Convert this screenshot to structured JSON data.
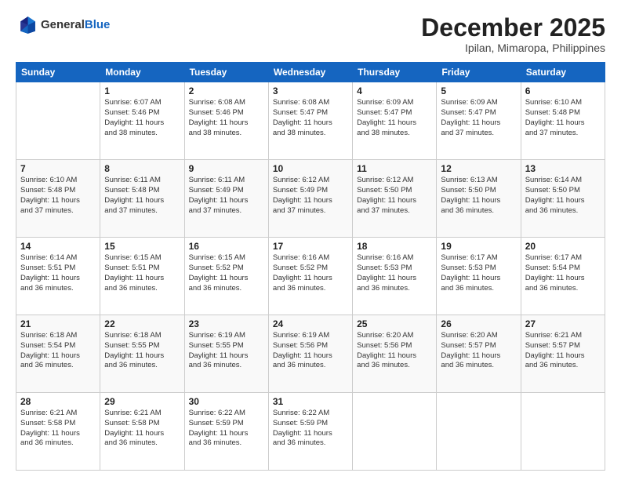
{
  "header": {
    "logo_line1": "General",
    "logo_line2": "Blue",
    "month": "December 2025",
    "location": "Ipilan, Mimaropa, Philippines"
  },
  "weekdays": [
    "Sunday",
    "Monday",
    "Tuesday",
    "Wednesday",
    "Thursday",
    "Friday",
    "Saturday"
  ],
  "weeks": [
    [
      {
        "day": "",
        "info": ""
      },
      {
        "day": "1",
        "info": "Sunrise: 6:07 AM\nSunset: 5:46 PM\nDaylight: 11 hours\nand 38 minutes."
      },
      {
        "day": "2",
        "info": "Sunrise: 6:08 AM\nSunset: 5:46 PM\nDaylight: 11 hours\nand 38 minutes."
      },
      {
        "day": "3",
        "info": "Sunrise: 6:08 AM\nSunset: 5:47 PM\nDaylight: 11 hours\nand 38 minutes."
      },
      {
        "day": "4",
        "info": "Sunrise: 6:09 AM\nSunset: 5:47 PM\nDaylight: 11 hours\nand 38 minutes."
      },
      {
        "day": "5",
        "info": "Sunrise: 6:09 AM\nSunset: 5:47 PM\nDaylight: 11 hours\nand 37 minutes."
      },
      {
        "day": "6",
        "info": "Sunrise: 6:10 AM\nSunset: 5:48 PM\nDaylight: 11 hours\nand 37 minutes."
      }
    ],
    [
      {
        "day": "7",
        "info": "Sunrise: 6:10 AM\nSunset: 5:48 PM\nDaylight: 11 hours\nand 37 minutes."
      },
      {
        "day": "8",
        "info": "Sunrise: 6:11 AM\nSunset: 5:48 PM\nDaylight: 11 hours\nand 37 minutes."
      },
      {
        "day": "9",
        "info": "Sunrise: 6:11 AM\nSunset: 5:49 PM\nDaylight: 11 hours\nand 37 minutes."
      },
      {
        "day": "10",
        "info": "Sunrise: 6:12 AM\nSunset: 5:49 PM\nDaylight: 11 hours\nand 37 minutes."
      },
      {
        "day": "11",
        "info": "Sunrise: 6:12 AM\nSunset: 5:50 PM\nDaylight: 11 hours\nand 37 minutes."
      },
      {
        "day": "12",
        "info": "Sunrise: 6:13 AM\nSunset: 5:50 PM\nDaylight: 11 hours\nand 36 minutes."
      },
      {
        "day": "13",
        "info": "Sunrise: 6:14 AM\nSunset: 5:50 PM\nDaylight: 11 hours\nand 36 minutes."
      }
    ],
    [
      {
        "day": "14",
        "info": "Sunrise: 6:14 AM\nSunset: 5:51 PM\nDaylight: 11 hours\nand 36 minutes."
      },
      {
        "day": "15",
        "info": "Sunrise: 6:15 AM\nSunset: 5:51 PM\nDaylight: 11 hours\nand 36 minutes."
      },
      {
        "day": "16",
        "info": "Sunrise: 6:15 AM\nSunset: 5:52 PM\nDaylight: 11 hours\nand 36 minutes."
      },
      {
        "day": "17",
        "info": "Sunrise: 6:16 AM\nSunset: 5:52 PM\nDaylight: 11 hours\nand 36 minutes."
      },
      {
        "day": "18",
        "info": "Sunrise: 6:16 AM\nSunset: 5:53 PM\nDaylight: 11 hours\nand 36 minutes."
      },
      {
        "day": "19",
        "info": "Sunrise: 6:17 AM\nSunset: 5:53 PM\nDaylight: 11 hours\nand 36 minutes."
      },
      {
        "day": "20",
        "info": "Sunrise: 6:17 AM\nSunset: 5:54 PM\nDaylight: 11 hours\nand 36 minutes."
      }
    ],
    [
      {
        "day": "21",
        "info": "Sunrise: 6:18 AM\nSunset: 5:54 PM\nDaylight: 11 hours\nand 36 minutes."
      },
      {
        "day": "22",
        "info": "Sunrise: 6:18 AM\nSunset: 5:55 PM\nDaylight: 11 hours\nand 36 minutes."
      },
      {
        "day": "23",
        "info": "Sunrise: 6:19 AM\nSunset: 5:55 PM\nDaylight: 11 hours\nand 36 minutes."
      },
      {
        "day": "24",
        "info": "Sunrise: 6:19 AM\nSunset: 5:56 PM\nDaylight: 11 hours\nand 36 minutes."
      },
      {
        "day": "25",
        "info": "Sunrise: 6:20 AM\nSunset: 5:56 PM\nDaylight: 11 hours\nand 36 minutes."
      },
      {
        "day": "26",
        "info": "Sunrise: 6:20 AM\nSunset: 5:57 PM\nDaylight: 11 hours\nand 36 minutes."
      },
      {
        "day": "27",
        "info": "Sunrise: 6:21 AM\nSunset: 5:57 PM\nDaylight: 11 hours\nand 36 minutes."
      }
    ],
    [
      {
        "day": "28",
        "info": "Sunrise: 6:21 AM\nSunset: 5:58 PM\nDaylight: 11 hours\nand 36 minutes."
      },
      {
        "day": "29",
        "info": "Sunrise: 6:21 AM\nSunset: 5:58 PM\nDaylight: 11 hours\nand 36 minutes."
      },
      {
        "day": "30",
        "info": "Sunrise: 6:22 AM\nSunset: 5:59 PM\nDaylight: 11 hours\nand 36 minutes."
      },
      {
        "day": "31",
        "info": "Sunrise: 6:22 AM\nSunset: 5:59 PM\nDaylight: 11 hours\nand 36 minutes."
      },
      {
        "day": "",
        "info": ""
      },
      {
        "day": "",
        "info": ""
      },
      {
        "day": "",
        "info": ""
      }
    ]
  ]
}
